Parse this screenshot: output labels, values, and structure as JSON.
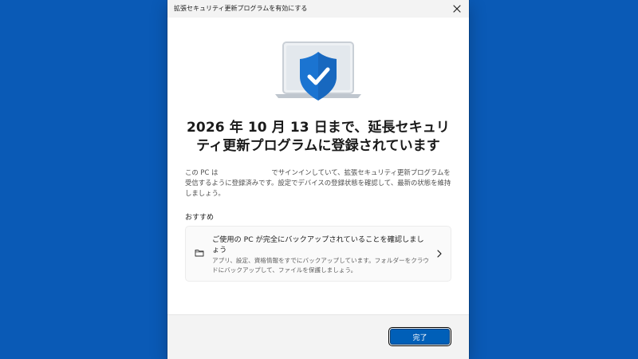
{
  "window": {
    "title": "拡張セキュリティ更新プログラムを有効にする"
  },
  "hero": {
    "icon": "laptop-shield-check-icon"
  },
  "main": {
    "heading": "2026 年 10 月 13 日まで、延長セキュリティ更新プログラムに登録されています",
    "description": "この PC は　　　　　　　　でサインインしていて、拡張セキュリティ更新プログラムを受信するように登録済みです。設定でデバイスの登録状態を確認して、最新の状態を維持しましょう。"
  },
  "recommendations": {
    "label": "おすすめ",
    "items": [
      {
        "icon": "folder-icon",
        "title": "ご使用の PC が完全にバックアップされていることを確認しましょう",
        "description": "アプリ、設定、資格情報をすでにバックアップしています。フォルダーをクラウドにバックアップして、ファイルを保護しましょう。"
      }
    ]
  },
  "footer": {
    "done_label": "完了"
  },
  "colors": {
    "desktop": "#0a5ab6",
    "accent": "#005fb8",
    "shield": "#1b74d1",
    "laptop_frame": "#c9cfd6",
    "laptop_screen": "#eef1f4"
  }
}
